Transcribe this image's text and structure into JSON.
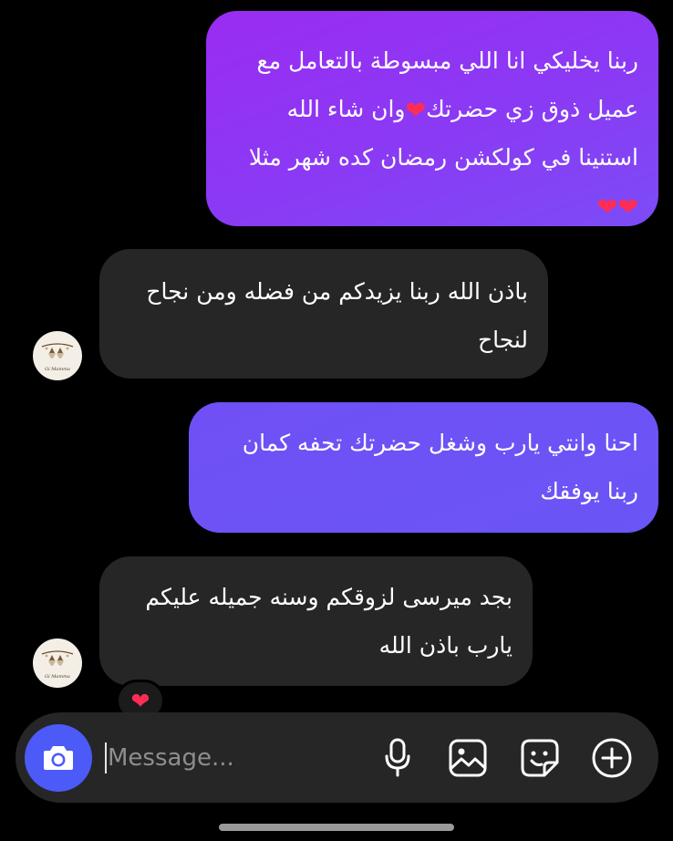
{
  "messages": [
    {
      "direction": "outgoing",
      "lines": [
        "ربنا يخليكي انا اللي مبسوطة بالتعامل مع",
        "وان شاء الله",
        "عميل ذوق زي حضرتك",
        "استنينا في كولكشن رمضان كده شهر مثلا"
      ],
      "emoji": [
        "red-heart",
        "red-heart",
        "red-heart"
      ]
    },
    {
      "direction": "incoming",
      "lines": [
        "باذن الله ربنا يزيدكم من فضله ومن نجاح",
        "لنجاح"
      ]
    },
    {
      "direction": "outgoing",
      "lines": [
        "احنا وانتي يارب وشغل حضرتك تحفه كمان",
        "ربنا يوفقك"
      ]
    },
    {
      "direction": "incoming",
      "lines": [
        "بجد ميرسى لزوقكم وسنه جميله عليكم",
        "يارب باذن الله"
      ],
      "reaction": "red-heart"
    }
  ],
  "avatar": {
    "text": "Gi Mamma"
  },
  "composer": {
    "placeholder": "Message...",
    "icons": [
      "camera-icon",
      "microphone-icon",
      "gallery-icon",
      "sticker-icon",
      "plus-icon"
    ]
  },
  "colors": {
    "outgoing_gradient_start": "#9a2cf2",
    "outgoing_gradient_end": "#6a55f6",
    "incoming_bubble": "#262626",
    "camera_button": "#4c5af7",
    "heart": "#ff2d55",
    "background": "#000000"
  }
}
